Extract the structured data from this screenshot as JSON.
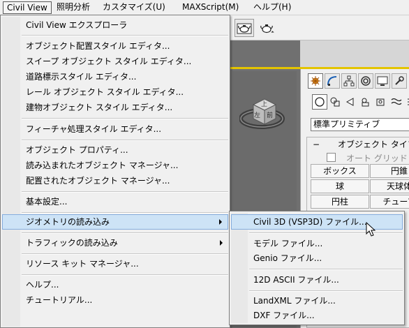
{
  "menubar": {
    "items": [
      {
        "label": "Civil View"
      },
      {
        "label": "照明分析"
      },
      {
        "label": "カスタマイズ(U)"
      },
      {
        "label": "MAXScript(M)"
      },
      {
        "label": "ヘルプ(H)"
      }
    ]
  },
  "civil_view_menu": {
    "items": [
      {
        "label": "Civil View エクスプローラ"
      },
      {
        "label": "オブジェクト配置スタイル エディタ..."
      },
      {
        "label": "スイープ オブジェクト スタイル エディタ..."
      },
      {
        "label": "道路標示スタイル エディタ..."
      },
      {
        "label": "レール オブジェクト スタイル エディタ..."
      },
      {
        "label": "建物オブジェクト スタイル エディタ..."
      },
      {
        "label": "フィーチャ処理スタイル エディタ..."
      },
      {
        "label": "オブジェクト プロパティ..."
      },
      {
        "label": "読み込まれたオブジェクト マネージャ..."
      },
      {
        "label": "配置されたオブジェクト マネージャ..."
      },
      {
        "label": "基本設定..."
      },
      {
        "label": "ジオメトリの読み込み"
      },
      {
        "label": "トラフィックの読み込み"
      },
      {
        "label": "リソース キット マネージャ..."
      },
      {
        "label": "ヘルプ..."
      },
      {
        "label": "チュートリアル..."
      }
    ]
  },
  "geometry_import_submenu": {
    "items": [
      {
        "label": "Civil 3D (VSP3D) ファイル..."
      },
      {
        "label": "モデル ファイル..."
      },
      {
        "label": "Genio ファイル..."
      },
      {
        "label": "12D ASCII ファイル..."
      },
      {
        "label": "LandXML ファイル..."
      },
      {
        "label": "DXF ファイル..."
      }
    ]
  },
  "viewcube": {
    "top_face": "上",
    "left_face": "左",
    "front_face": "前"
  },
  "command_panel": {
    "category_dropdown": "標準プリミティブ",
    "rollout_title": "オブジェクト タイプ",
    "rollout_toggle": "−",
    "autogrid_label": "オート グリッド",
    "buttons": [
      "ボックス",
      "円錐",
      "球",
      "天球体",
      "円柱",
      "チューブ"
    ]
  },
  "colors": {
    "menu_bg": "#f0f0f0",
    "highlight_bg": "#cde3f6",
    "highlight_border": "#84acdd",
    "viewport_border": "#e4c400"
  },
  "icons": [
    "teapot-render-icon",
    "teapot-icon",
    "create-tab-icon",
    "modify-tab-icon",
    "hierarchy-tab-icon",
    "motion-tab-icon",
    "display-tab-icon",
    "utilities-tab-icon",
    "geometry-icon",
    "shapes-icon",
    "lights-icon",
    "cameras-icon",
    "helpers-icon",
    "spacewarps-icon",
    "systems-icon",
    "submenu-arrow-icon",
    "mouse-cursor-icon"
  ]
}
